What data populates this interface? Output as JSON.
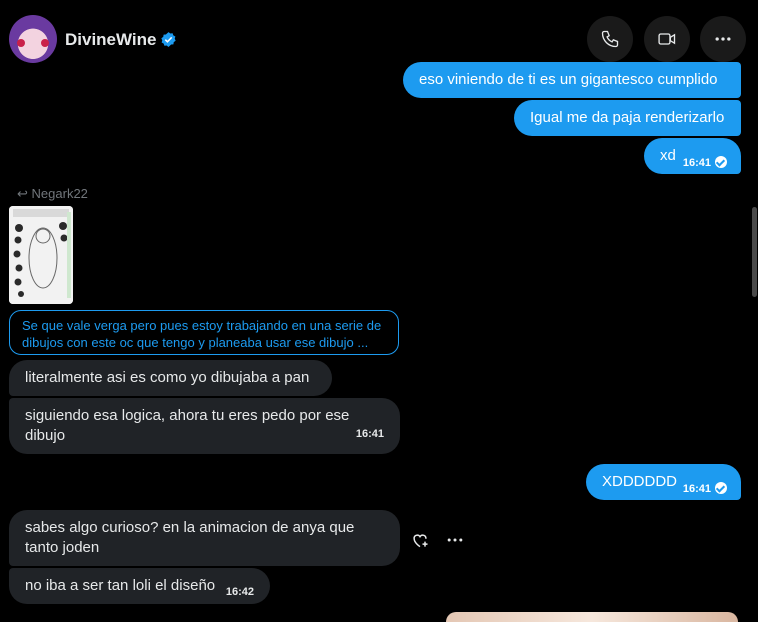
{
  "header": {
    "name": "DivineWine",
    "call_label": "phone-call",
    "video_label": "video-call",
    "more_label": "more-options"
  },
  "messages": {
    "out1": "eso viniendo de ti es un gigantesco cumplido",
    "out2": "Igual me da paja renderizarlo",
    "out3": "xd",
    "out3_time": "16:41",
    "reply_to": "Negark22",
    "quote_text": "Se que vale verga pero pues estoy trabajando en una serie de dibujos con este oc que tengo y planeaba usar ese dibujo ...",
    "in1": "literalmente asi es como yo dibujaba a pan",
    "in2": "siguiendo esa logica, ahora tu eres pedo por ese dibujo",
    "in2_time": "16:41",
    "out4": "XDDDDDD",
    "out4_time": "16:41",
    "in3": "sabes algo curioso? en la animacion de anya que tanto joden",
    "in4": "no iba a ser tan loli el diseño",
    "in4_time": "16:42"
  },
  "colors": {
    "accent": "#1d9bf0",
    "incoming_bubble": "#202327",
    "background": "#000000"
  }
}
